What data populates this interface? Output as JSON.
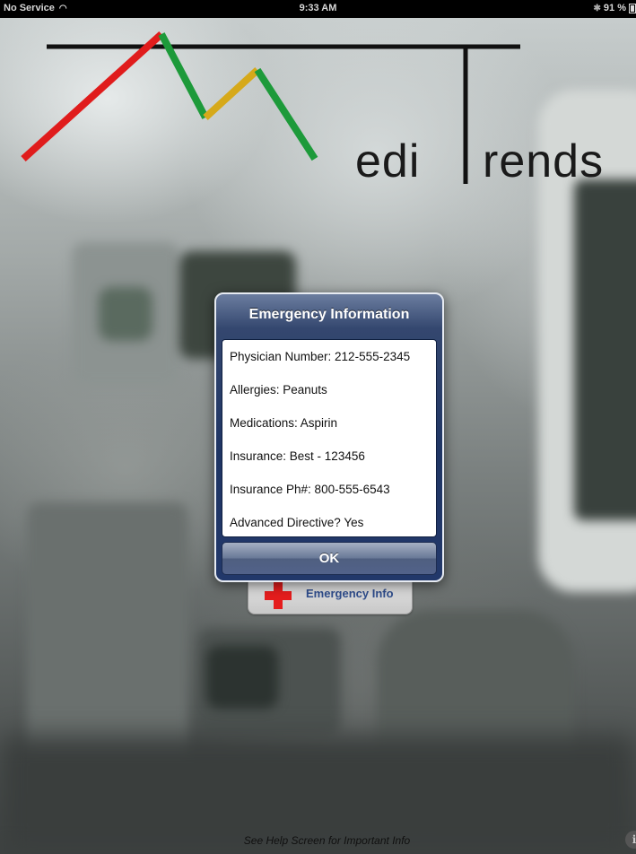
{
  "status_bar": {
    "carrier": "No Service",
    "time": "9:33 AM",
    "battery_percent": "91 %"
  },
  "logo": {
    "text_left": "edi",
    "text_right": "rends",
    "colors": {
      "red": "#e01c1c",
      "green": "#1d9a3a",
      "yellow": "#d6a91a",
      "black": "#111111"
    }
  },
  "emergency_button": {
    "label": "Emergency Info",
    "icon": "red-cross-icon"
  },
  "alert": {
    "title": "Emergency Information",
    "rows": [
      "Physician Number: 212-555-2345",
      "Allergies: Peanuts",
      "Medications: Aspirin",
      "Insurance: Best - 123456",
      "Insurance Ph#: 800-555-6543",
      "Advanced Directive? Yes"
    ],
    "ok_label": "OK"
  },
  "footer": {
    "help_text": "See Help Screen for Important Info",
    "info_icon": "i"
  }
}
